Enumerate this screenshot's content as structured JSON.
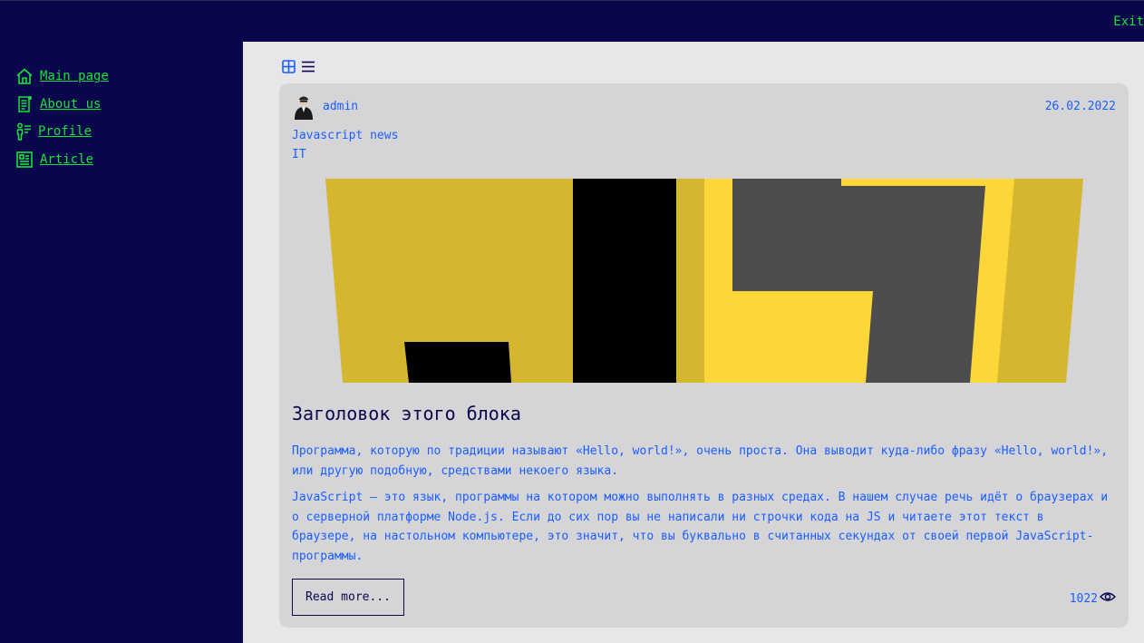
{
  "header": {
    "exit_label": "Exit"
  },
  "sidebar": {
    "items": [
      {
        "label": "Main page",
        "icon": "home-icon"
      },
      {
        "label": "About us",
        "icon": "document-icon"
      },
      {
        "label": "Profile",
        "icon": "profile-icon"
      },
      {
        "label": "Article",
        "icon": "article-icon"
      }
    ]
  },
  "view_toggles": [
    "grid-view-icon",
    "list-view-icon"
  ],
  "article": {
    "author": "admin",
    "date": "26.02.2022",
    "subtitle": "Javascript news",
    "tag": "IT",
    "image": "js-logo-image",
    "title": "Заголовок этого блока",
    "paragraphs": [
      "Программа, которую по традиции называют «Hello, world!», очень проста. Она выводит куда-либо фразу «Hello, world!», или другую подобную, средствами некоего языка.",
      "JavaScript — это язык, программы на котором можно выполнять в разных средах. В нашем случае речь идёт о браузерах и о серверной платформе Node.js. Если до сих пор вы не написали ни строчки кода на JS и читаете этот текст в браузере, на настольном компьютере, это значит, что вы буквально в считанных секундах от своей первой JavaScript-программы."
    ],
    "read_more_label": "Read more...",
    "views": "1022"
  },
  "colors": {
    "navy": "#09064c",
    "green": "#18e23a",
    "blue": "#1a5dff",
    "card": "#d5d5d8",
    "main_bg": "#e7e7ea"
  }
}
